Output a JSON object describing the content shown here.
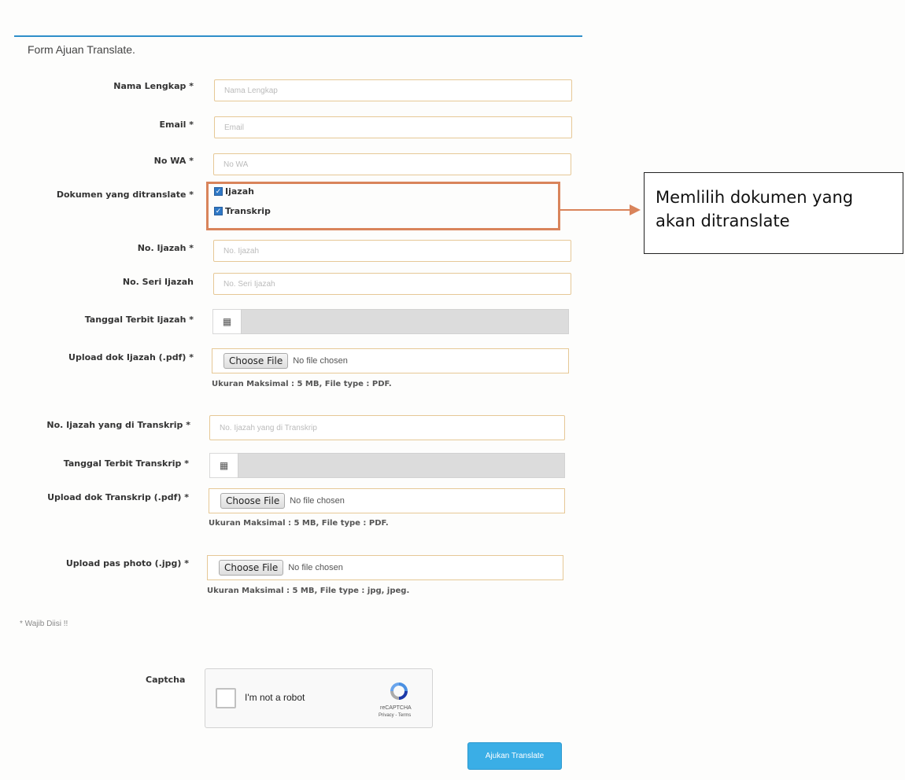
{
  "form": {
    "title": "Form Ajuan Translate."
  },
  "fields": {
    "nama": {
      "label": "Nama Lengkap *",
      "placeholder": "Nama Lengkap"
    },
    "email": {
      "label": "Email *",
      "placeholder": "Email"
    },
    "wa": {
      "label": "No WA *",
      "placeholder": "No WA"
    },
    "dokumen": {
      "label": "Dokumen yang ditranslate *",
      "options": [
        {
          "label": "Ijazah",
          "checked": true
        },
        {
          "label": "Transkrip",
          "checked": true
        }
      ]
    },
    "no_ijazah": {
      "label": "No. Ijazah *",
      "placeholder": "No. Ijazah"
    },
    "no_seri": {
      "label": "No. Seri Ijazah",
      "placeholder": "No. Seri Ijazah"
    },
    "tgl_ijazah": {
      "label": "Tanggal Terbit Ijazah *",
      "icon": "calendar-icon"
    },
    "upload_ijazah": {
      "label": "Upload dok Ijazah (.pdf) *",
      "button": "Choose File",
      "status": "No file chosen",
      "hint": "Ukuran Maksimal : 5 MB, File type : PDF."
    },
    "no_ijazah_transkrip": {
      "label": "No. Ijazah yang di Transkrip *",
      "placeholder": "No. Ijazah yang di Transkrip"
    },
    "tgl_transkrip": {
      "label": "Tanggal Terbit Transkrip *",
      "icon": "calendar-icon"
    },
    "upload_transkrip": {
      "label": "Upload dok Transkrip (.pdf) *",
      "button": "Choose File",
      "status": "No file chosen",
      "hint": "Ukuran Maksimal : 5 MB, File type : PDF."
    },
    "upload_photo": {
      "label": "Upload pas photo (.jpg) *",
      "button": "Choose File",
      "status": "No file chosen",
      "hint": "Ukuran Maksimal : 5 MB, File type : jpg, jpeg."
    }
  },
  "required_note": "* Wajib Diisi !!",
  "captcha": {
    "label": "Captcha",
    "checkbox_text": "I'm not a robot",
    "brand": "reCAPTCHA",
    "links": "Privacy - Terms"
  },
  "submit_label": "Ajukan Translate",
  "annotation": {
    "callout_text": "Memlilih dokumen yang akan ditranslate",
    "color": "#d9845b"
  },
  "colors": {
    "accent": "#2f8fc9",
    "button": "#3aaee6",
    "input_border": "#e6c896",
    "checkbox": "#2f78c6"
  }
}
